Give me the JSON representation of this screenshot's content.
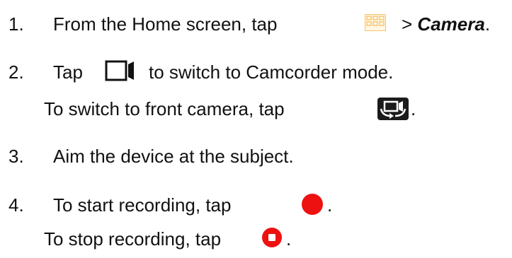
{
  "steps": [
    {
      "number": "1.",
      "text_before": "From the Home screen, tap",
      "icon": "apps-grid-icon",
      "text_after": "> ",
      "emphasis": "Camera",
      "end": "."
    },
    {
      "number": "2.",
      "text_before": "Tap",
      "icon": "camcorder-mode-icon",
      "text_after": "to switch to Camcorder mode.",
      "sub": {
        "text_before": "To switch to front camera, tap",
        "icon": "switch-camera-icon",
        "end": "."
      }
    },
    {
      "number": "3.",
      "text": "Aim the device at the subject."
    },
    {
      "number": "4.",
      "text_before": "To start recording, tap",
      "icon": "record-icon",
      "end": ".",
      "sub": {
        "text_before": "To stop recording, tap",
        "icon": "stop-icon",
        "end": "."
      }
    }
  ],
  "colors": {
    "text": "#111111",
    "grid_icon": "#f4c56a",
    "record_red": "#ee1111"
  }
}
